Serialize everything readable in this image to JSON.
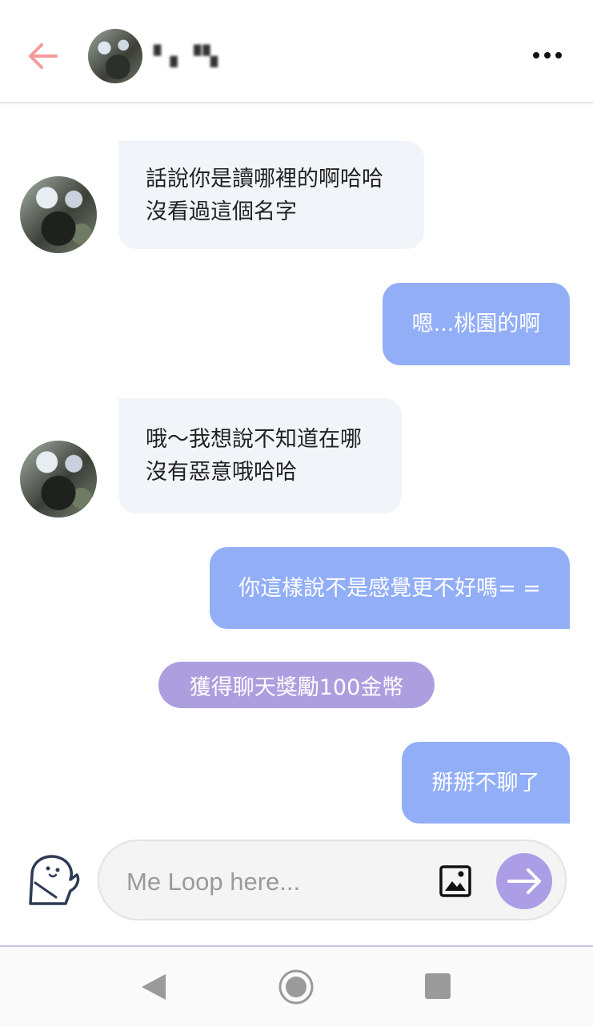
{
  "header": {
    "contact_name": "▘▖▝▚"
  },
  "messages": [
    {
      "side": "in",
      "lines": [
        "話說你是讀哪裡的啊哈哈",
        "沒看過這個名字"
      ]
    },
    {
      "side": "out",
      "text": "嗯...桃園的啊"
    },
    {
      "side": "in",
      "lines": [
        "哦～我想說不知道在哪",
        "沒有惡意哦哈哈"
      ]
    },
    {
      "side": "out",
      "text": "你這樣說不是感覺更不好嗎= ="
    },
    {
      "side": "system",
      "text": "獲得聊天獎勵100金幣"
    },
    {
      "side": "out",
      "text": "掰掰不聊了"
    }
  ],
  "composer": {
    "placeholder": "Me Loop here..."
  },
  "icons": {
    "back": "arrow-left-icon",
    "menu": "more-dots-icon",
    "mascot": "mascot-icon",
    "image": "image-icon",
    "send": "arrow-right-icon"
  },
  "colors": {
    "accent_back_arrow": "#f59a9a",
    "incoming_bubble": "#f1f5fa",
    "outgoing_bubble": "#92aef7",
    "system_pill": "#ad9fdf",
    "send_button": "#ab9ee6"
  }
}
